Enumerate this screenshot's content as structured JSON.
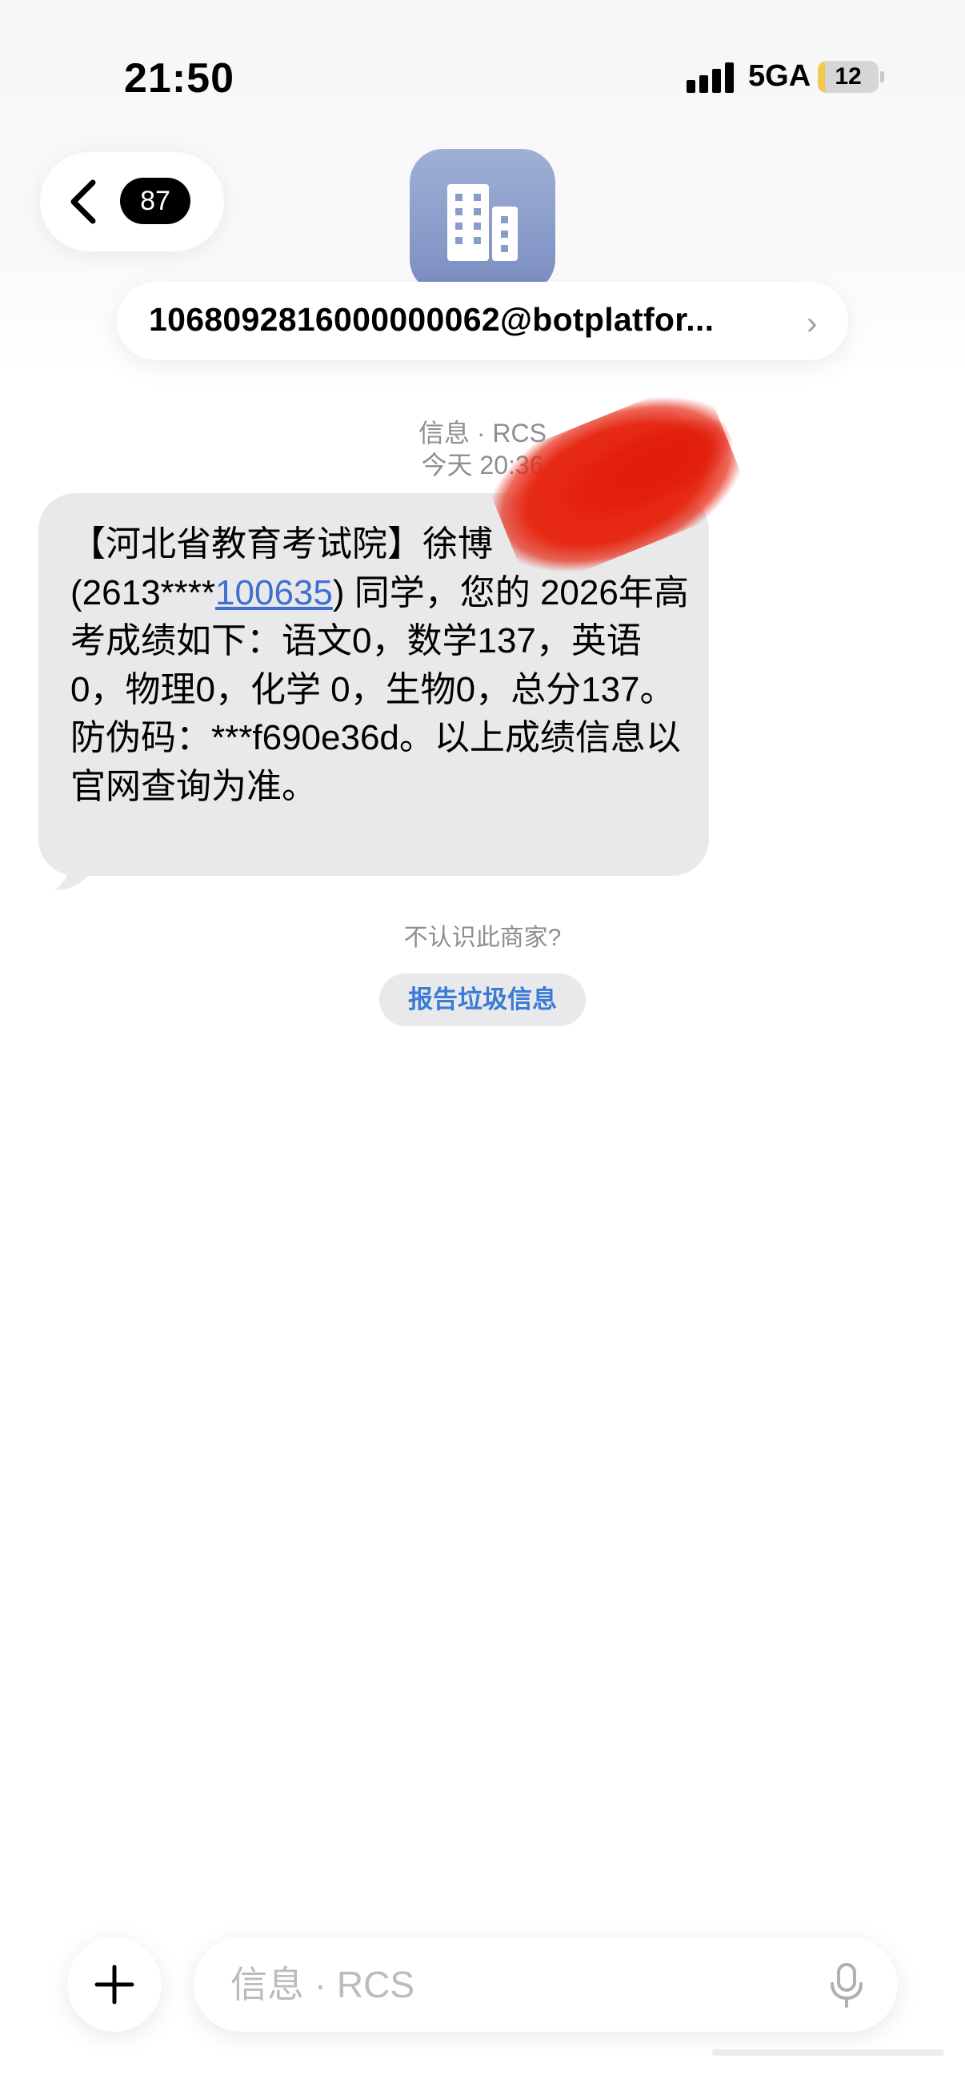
{
  "status_bar": {
    "time": "21:50",
    "network": "5GA",
    "battery": "12",
    "battery_level": 0.12,
    "signal_icon": "cellular-signal-icon"
  },
  "header": {
    "back_icon": "chevron-left-icon",
    "unread_count": "87",
    "avatar_icon": "building-icon",
    "sender": "1068092816000000062@botplatfor...",
    "sender_chevron": "›"
  },
  "conversation": {
    "service": "信息 · RCS",
    "timestamp": "今天 20:36",
    "message": {
      "part1": "【河北省教育考试院】徐博",
      "part2": "(2613****",
      "link": "100635",
      "part3": ") 同学，您的 2026年高考成绩如下：语文0，数学137，英语0，物理0，化学 0，生物0，总分137。防伪码：***f690e36d。以上成绩信息以官网查询为准。"
    },
    "unknown_prompt": "不认识此商家?",
    "report_button": "报告垃圾信息"
  },
  "composer": {
    "plus_icon": "plus-icon",
    "placeholder": "信息 · RCS",
    "mic_icon": "microphone-icon"
  },
  "colors": {
    "bubble": "#e9e9eb",
    "link": "#3f6fd1",
    "report_text": "#3a7bd5",
    "redaction": "#e8220f"
  }
}
